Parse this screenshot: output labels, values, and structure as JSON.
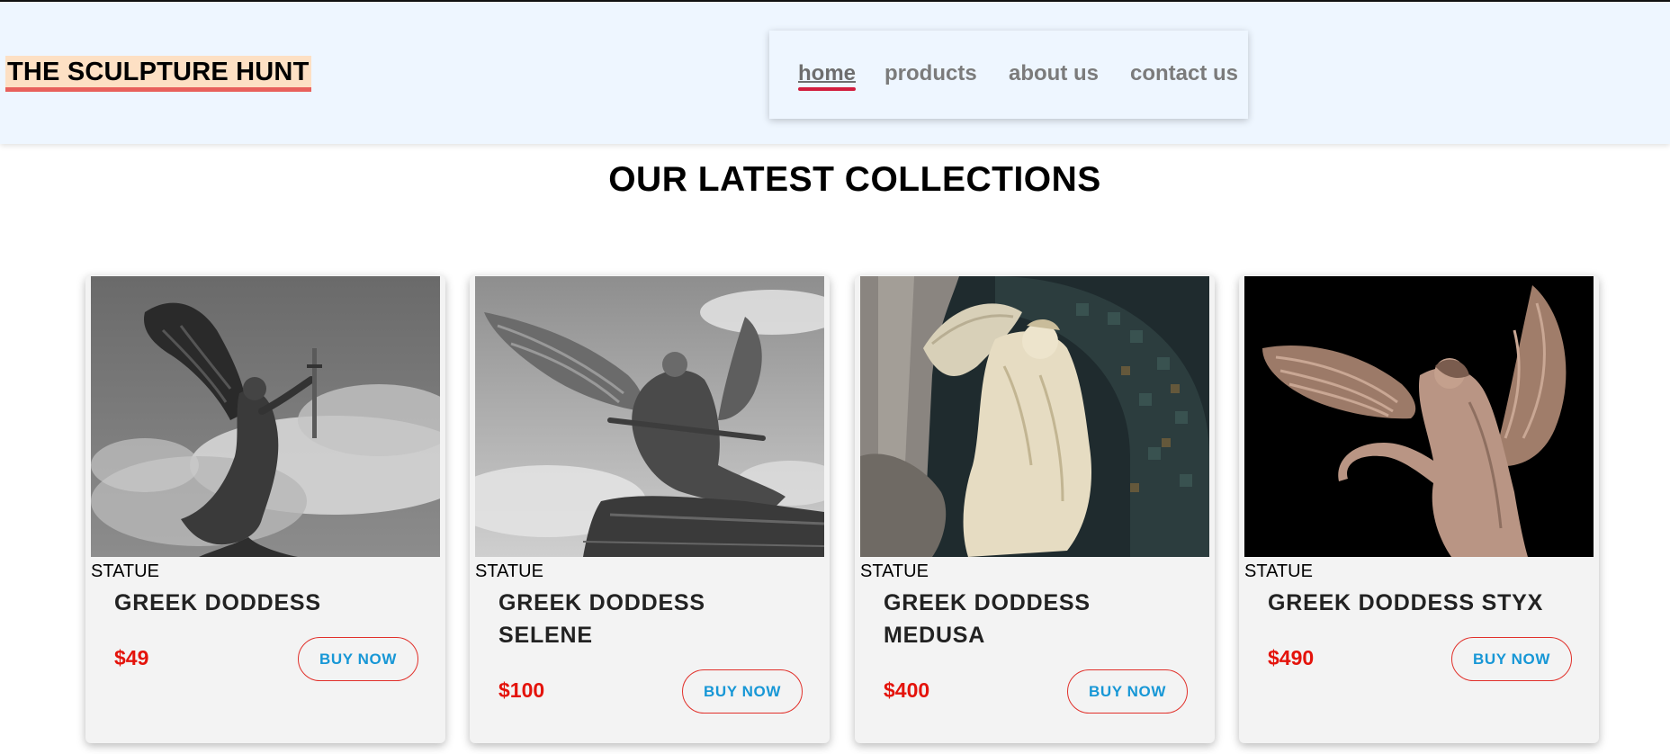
{
  "site": {
    "logo": "THE SCULPTURE HUNT"
  },
  "nav": {
    "items": [
      {
        "label": "home",
        "active": true
      },
      {
        "label": "products",
        "active": false
      },
      {
        "label": "about us",
        "active": false
      },
      {
        "label": "contact us",
        "active": false
      }
    ]
  },
  "main": {
    "title": "OUR LATEST COLLECTIONS"
  },
  "products": [
    {
      "category": "STATUE",
      "name": "GREEK DODDESS",
      "price": "$49",
      "button": "BUY NOW"
    },
    {
      "category": "STATUE",
      "name": "GREEK DODDESS SELENE",
      "price": "$100",
      "button": "BUY NOW"
    },
    {
      "category": "STATUE",
      "name": "GREEK DODDESS MEDUSA",
      "price": "$400",
      "button": "BUY NOW"
    },
    {
      "category": "STATUE",
      "name": "GREEK DODDESS STYX",
      "price": "$490",
      "button": "BUY NOW"
    }
  ],
  "colors": {
    "header_bg": "#eef6ff",
    "logo_highlight": "#fde0c4",
    "logo_underline": "#e8605c",
    "nav_active_underline": "#d21e3f",
    "price": "#e4130b",
    "button_text": "#1797d6",
    "button_border": "#e1302a",
    "card_bg": "#f3f3f3"
  }
}
